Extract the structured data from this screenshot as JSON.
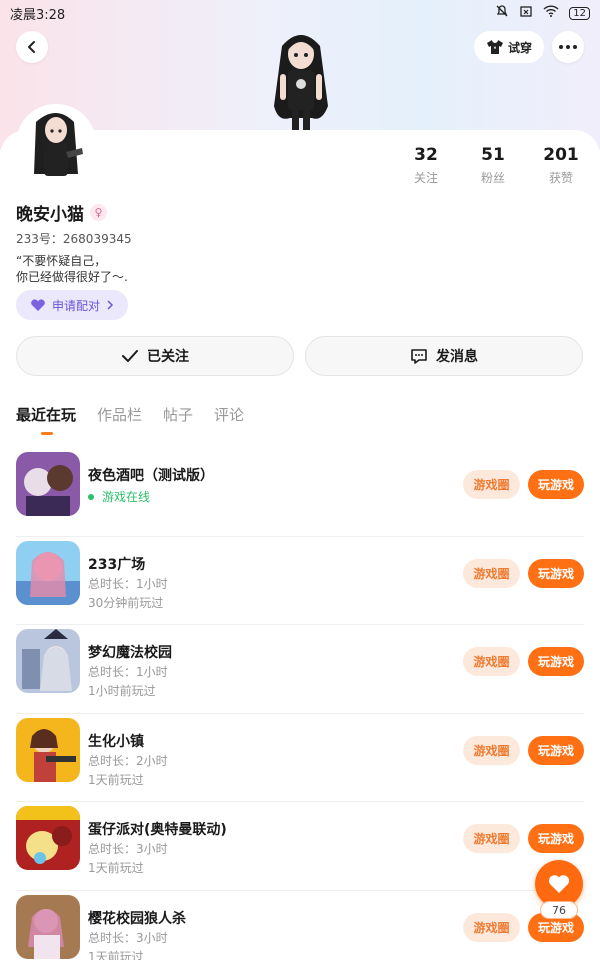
{
  "status_bar": {
    "time": "凌晨3:28",
    "battery": "12"
  },
  "header": {
    "try_on_label": "试穿"
  },
  "profile": {
    "name": "晚安小猫",
    "gender_symbol": "♀",
    "uid": "233号：268039345",
    "bio": "“不要怀疑自己，\n你已经做得很好了～.",
    "pair_label": "申请配对",
    "stats": [
      {
        "num": "32",
        "label": "关注"
      },
      {
        "num": "51",
        "label": "粉丝"
      },
      {
        "num": "201",
        "label": "获赞"
      }
    ]
  },
  "actions": {
    "followed_label": "已关注",
    "message_label": "发消息"
  },
  "tabs": [
    "最近在玩",
    "作品栏",
    "帖子",
    "评论"
  ],
  "games": [
    {
      "name": "夜色酒吧（测试版）",
      "line1": "游戏在线",
      "line2": "",
      "online": true
    },
    {
      "name": "233广场",
      "line1": "总时长：1小时",
      "line2": "30分钟前玩过",
      "online": false
    },
    {
      "name": "梦幻魔法校园",
      "line1": "总时长：1小时",
      "line2": "1小时前玩过",
      "online": false
    },
    {
      "name": "生化小镇",
      "line1": "总时长：2小时",
      "line2": "1天前玩过",
      "online": false
    },
    {
      "name": "蛋仔派对(奥特曼联动)",
      "line1": "总时长：3小时",
      "line2": "1天前玩过",
      "online": false
    },
    {
      "name": "樱花校园狼人杀",
      "line1": "总时长：3小时",
      "line2": "1天前玩过",
      "online": false
    }
  ],
  "game_buttons": {
    "circle": "游戏圈",
    "play": "玩游戏"
  },
  "fab": {
    "count": "76"
  },
  "colors": {
    "accent": "#ff6f13",
    "online": "#2cbf6a",
    "pair": "#6b55d8"
  }
}
